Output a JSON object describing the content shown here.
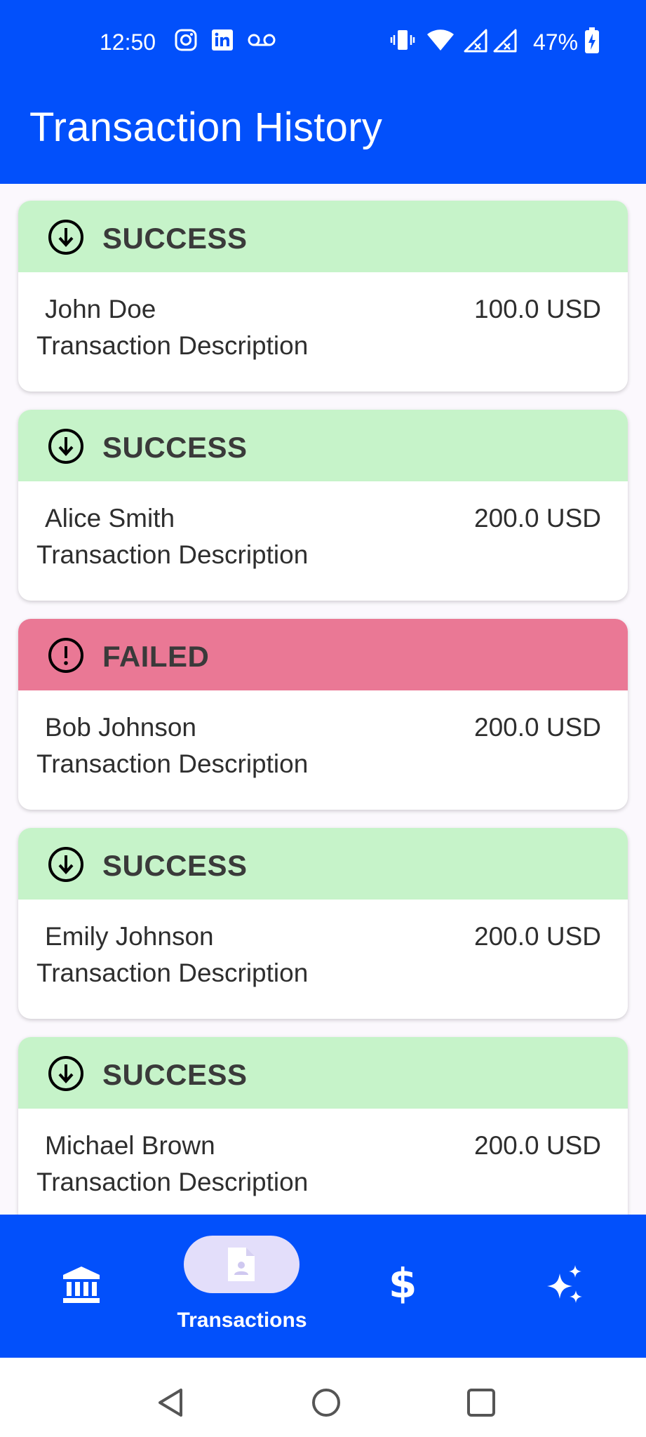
{
  "status_bar": {
    "time": "12:50",
    "battery": "47%",
    "icons": [
      "instagram-icon",
      "linkedin-icon",
      "voicemail-icon",
      "vibrate-icon",
      "wifi-icon",
      "signal-icon",
      "signal-icon",
      "battery-charging-icon"
    ]
  },
  "app_bar": {
    "title": "Transaction History"
  },
  "transactions": [
    {
      "status": "SUCCESS",
      "status_icon": "arrow-down-circle-icon",
      "name": "John Doe",
      "amount": "100.0 USD",
      "description": "Transaction Description"
    },
    {
      "status": "SUCCESS",
      "status_icon": "arrow-down-circle-icon",
      "name": "Alice Smith",
      "amount": "200.0 USD",
      "description": "Transaction Description"
    },
    {
      "status": "FAILED",
      "status_icon": "exclamation-circle-icon",
      "name": "Bob Johnson",
      "amount": "200.0 USD",
      "description": "Transaction Description"
    },
    {
      "status": "SUCCESS",
      "status_icon": "arrow-down-circle-icon",
      "name": "Emily Johnson",
      "amount": "200.0 USD",
      "description": "Transaction Description"
    },
    {
      "status": "SUCCESS",
      "status_icon": "arrow-down-circle-icon",
      "name": "Michael Brown",
      "amount": "200.0 USD",
      "description": "Transaction Description"
    }
  ],
  "bottom_nav": {
    "items": [
      {
        "icon": "bank-icon",
        "label": ""
      },
      {
        "icon": "document-person-icon",
        "label": "Transactions",
        "selected": true
      },
      {
        "icon": "dollar-icon",
        "label": ""
      },
      {
        "icon": "sparkle-icon",
        "label": ""
      }
    ]
  },
  "colors": {
    "primary": "#0250fb",
    "success_bg": "#c6f3c9",
    "failed_bg": "#ea7895",
    "nav_pill": "#e3defa"
  }
}
